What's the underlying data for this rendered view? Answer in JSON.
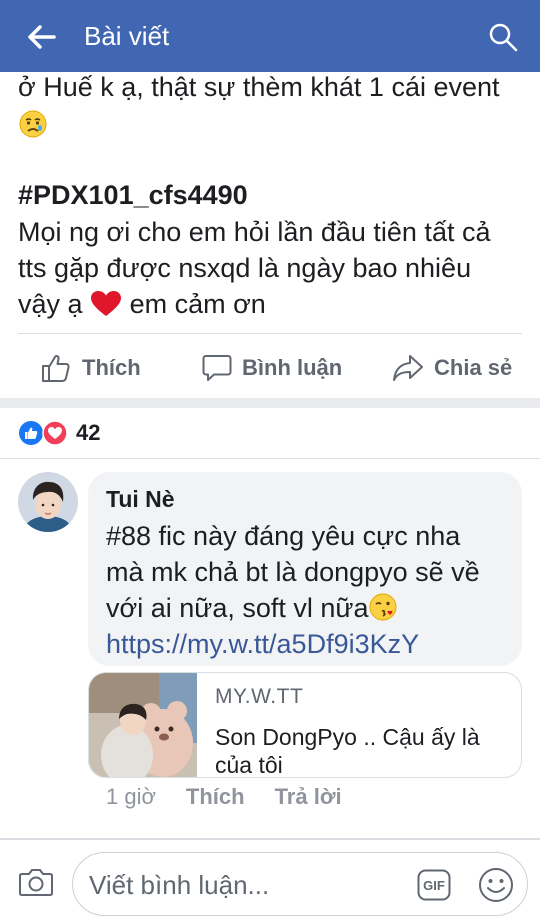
{
  "header": {
    "title": "Bài viết",
    "back_icon": "arrow-left-icon",
    "search_icon": "search-icon",
    "bg_color": "#4267b2"
  },
  "post": {
    "line1": "ở Huế k ạ, thật sự thèm khát 1 cái event",
    "hashtag": "#PDX101_cfs4490",
    "body_line1": "Mọi ng ơi cho em hỏi lần đầu tiên tất cả",
    "body_line2": "tts gặp được nsxqd là ngày bao nhiêu",
    "body_line3_a": "vậy ạ",
    "body_line3_b": "em cảm ơn"
  },
  "actions": {
    "like": "Thích",
    "comment": "Bình luận",
    "share": "Chia sẻ"
  },
  "reactions": {
    "count": "42",
    "like_color": "#1877f2",
    "love_color": "#f33e58"
  },
  "comment": {
    "author": "Tui Nè",
    "line1": "#88 fic này đáng yêu cực nha",
    "line2": "mà mk chả bt là dongpyo sẽ về",
    "line3": "với ai nữa, soft vl nữa",
    "link": "https://my.w.tt/a5Df9i3KzY",
    "preview": {
      "domain": "MY.W.TT",
      "title": "Son DongPyo .. Cậu ấy là của tôi"
    },
    "time": "1 giờ",
    "like": "Thích",
    "reply": "Trả lời"
  },
  "composer": {
    "placeholder": "Viết bình luận...",
    "gif": "GIF"
  }
}
